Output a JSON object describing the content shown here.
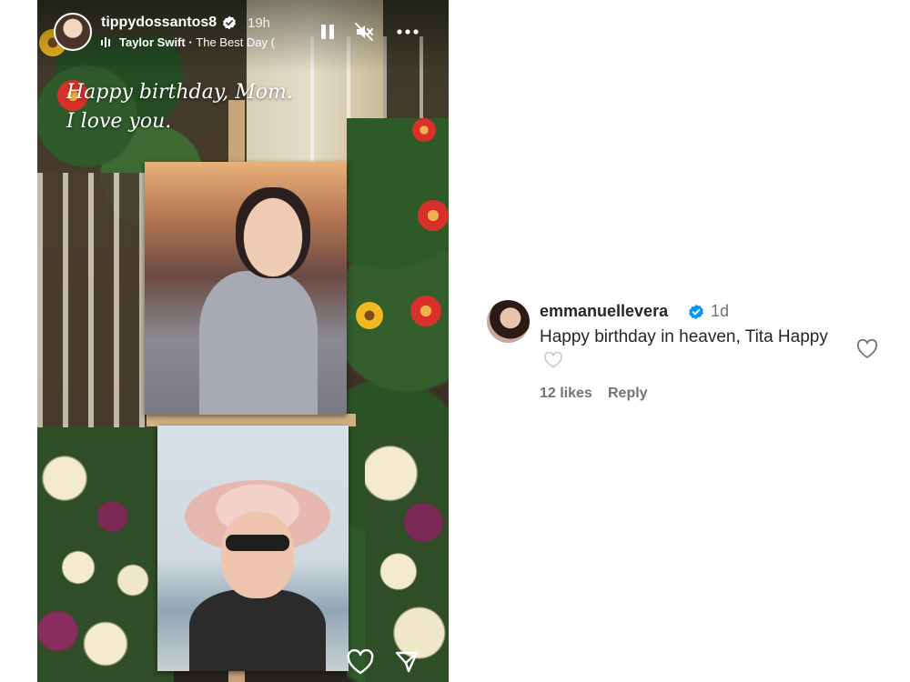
{
  "story": {
    "username": "tippydossantos8",
    "time": "19h",
    "music": {
      "artist": "Taylor Swift",
      "separator": " · ",
      "song": "The Best Day ("
    },
    "caption_line1": "Happy birthday, Mom.",
    "caption_line2": "I love you.",
    "icons": [
      "pause-icon",
      "mute-icon",
      "more-icon",
      "heart-icon",
      "send-icon"
    ]
  },
  "comment": {
    "username": "emmanuellevera",
    "time": "1d",
    "text": "Happy birthday in heaven, Tita Happy",
    "likes": "12 likes",
    "reply": "Reply",
    "icons": [
      "verified-badge-icon",
      "inline-heart-icon",
      "like-heart-icon"
    ]
  },
  "colors": {
    "verified_blue": "#0095f6",
    "text_primary": "#262626",
    "text_secondary": "#737373",
    "background": "#ffffff"
  }
}
